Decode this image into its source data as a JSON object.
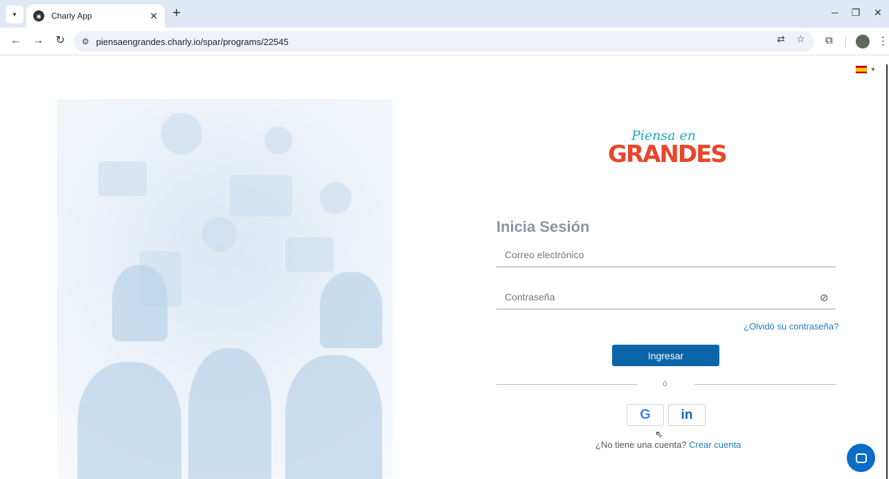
{
  "browser": {
    "tab_title": "Charly App",
    "tab_icon": "charly-favicon",
    "url": "piensaengrandes.charly.io/spar/programs/22545"
  },
  "page": {
    "logo_script": "Piensa en",
    "logo_word": "GRANDES",
    "title": "Inicia Sesión",
    "email_placeholder": "Correo electrónico",
    "password_placeholder": "Contraseña",
    "forgot_password": "¿Olvidó su contraseña?",
    "login_button": "Ingresar",
    "separator": "ó",
    "no_account": "¿No tiene una cuenta?",
    "create_account": "Crear cuenta",
    "language": "es"
  },
  "colors": {
    "primary": "#0b65a8",
    "link": "#1f7bbf",
    "logo_orange": "#e8462c",
    "logo_teal": "#1aa7b8",
    "title_gray": "#8a93a8"
  }
}
